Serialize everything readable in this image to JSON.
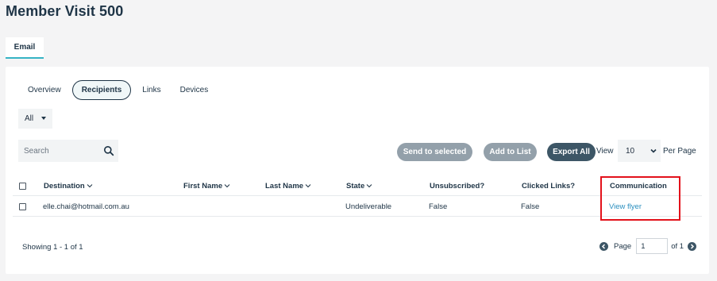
{
  "page": {
    "title": "Member Visit 500"
  },
  "main_tabs": [
    {
      "label": "Email"
    }
  ],
  "sub_tabs": [
    {
      "label": "Overview"
    },
    {
      "label": "Recipients"
    },
    {
      "label": "Links"
    },
    {
      "label": "Devices"
    }
  ],
  "filter": {
    "selected": "All"
  },
  "search": {
    "placeholder": "Search"
  },
  "actions": {
    "send_to_selected": "Send to selected",
    "add_to_list": "Add to List",
    "export_all": "Export All"
  },
  "per_page": {
    "view_label": "View",
    "selected": "10",
    "suffix": "Per Page"
  },
  "table": {
    "columns": [
      "Destination",
      "First Name",
      "Last Name",
      "State",
      "Unsubscribed?",
      "Clicked Links?",
      "Communication"
    ],
    "rows": [
      {
        "destination": "elle.chai@hotmail.com.au",
        "first_name": "",
        "last_name": "",
        "state": "Undeliverable",
        "unsubscribed": "False",
        "clicked_links": "False",
        "communication": "View flyer"
      }
    ]
  },
  "footer": {
    "showing": "Showing 1 - 1 of 1",
    "page_label": "Page",
    "page_value": "1",
    "of_label": "of 1"
  },
  "colors": {
    "accent": "#36b3c4",
    "primary_button": "#3d5666",
    "disabled_button": "#93a0aa",
    "link": "#2a8fbf",
    "highlight": "#e3121b"
  }
}
